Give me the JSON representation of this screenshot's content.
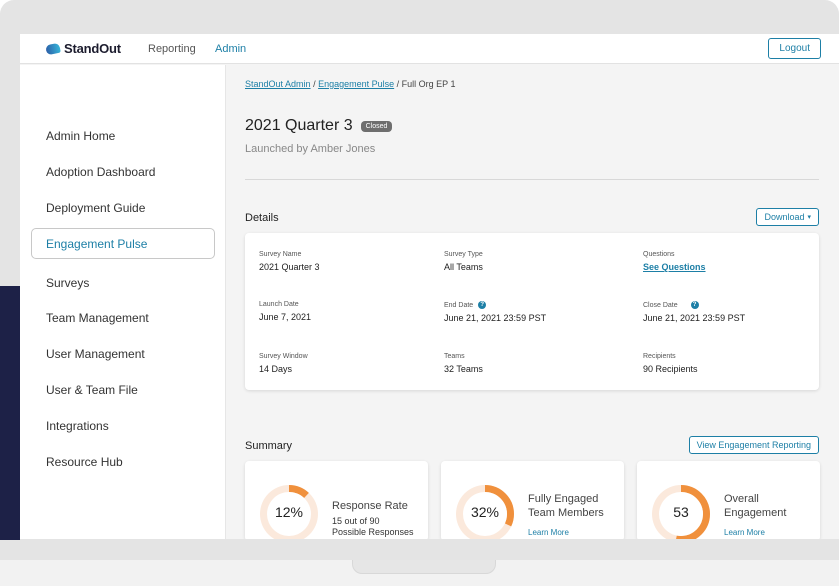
{
  "brand": {
    "name": "StandOut"
  },
  "nav": {
    "reporting": "Reporting",
    "admin": "Admin",
    "logout": "Logout"
  },
  "sidebar": {
    "items": [
      {
        "label": "Admin Home"
      },
      {
        "label": "Adoption Dashboard"
      },
      {
        "label": "Deployment Guide"
      },
      {
        "label": "Engagement Pulse"
      },
      {
        "label": "Surveys"
      },
      {
        "label": "Team Management"
      },
      {
        "label": "User Management"
      },
      {
        "label": "User & Team File"
      },
      {
        "label": "Integrations"
      },
      {
        "label": "Resource Hub"
      }
    ]
  },
  "breadcrumb": {
    "root": "StandOut Admin",
    "section": "Engagement Pulse",
    "current": "/ Full Org EP 1",
    "sep": "/"
  },
  "header": {
    "title": "2021 Quarter 3",
    "status": "Closed",
    "subtitle": "Launched by Amber Jones"
  },
  "details": {
    "title": "Details",
    "download_label": "Download",
    "fields": {
      "survey_name": {
        "label": "Survey Name",
        "value": "2021 Quarter 3"
      },
      "survey_type": {
        "label": "Survey Type",
        "value": "All Teams"
      },
      "questions": {
        "label": "Questions",
        "value": "See Questions"
      },
      "launch_date": {
        "label": "Launch Date",
        "value": "June 7, 2021"
      },
      "end_date": {
        "label": "End Date",
        "value": "June 21, 2021 23:59 PST"
      },
      "close_date": {
        "label": "Close Date",
        "value": "June 21, 2021 23:59 PST"
      },
      "survey_window": {
        "label": "Survey Window",
        "value": "14 Days"
      },
      "teams": {
        "label": "Teams",
        "value": "32 Teams"
      },
      "recipients": {
        "label": "Recipients",
        "value": "90 Recipients"
      }
    }
  },
  "summary": {
    "title": "Summary",
    "view_reporting_label": "View Engagement Reporting",
    "cards": [
      {
        "value": "12%",
        "fill": 0.12,
        "title": "Response Rate",
        "sub1": "15 out of 90",
        "sub2": "Possible Responses",
        "link": ""
      },
      {
        "value": "32%",
        "fill": 0.32,
        "title1": "Fully Engaged",
        "title2": "Team Members",
        "link": "Learn More"
      },
      {
        "value": "53",
        "fill": 0.53,
        "title1": "Overall",
        "title2": "Engagement",
        "link": "Learn More"
      }
    ]
  },
  "colors": {
    "accent": "#1d7fa6",
    "gauge_arc": "#f0903c",
    "gauge_track": "#fbe9dc",
    "badge": "#6e6e6e"
  }
}
